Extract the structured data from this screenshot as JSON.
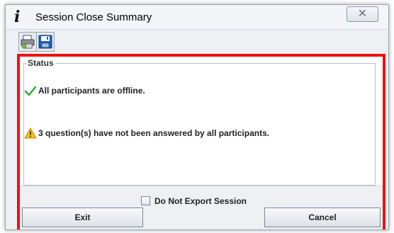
{
  "window": {
    "title": "Session Close Summary",
    "title_icon": "info-icon",
    "close_glyph": "✕"
  },
  "toolbar": {
    "buttons": [
      {
        "name": "print",
        "icon": "printer-icon"
      },
      {
        "name": "save",
        "icon": "floppy-disk-icon"
      }
    ]
  },
  "status": {
    "legend": "Status",
    "items": [
      {
        "icon": "check-icon",
        "text": "All participants are offline."
      },
      {
        "icon": "warning-icon",
        "text": "3 question(s) have not been answered by all participants."
      }
    ]
  },
  "options": {
    "do_not_export_label": "Do Not Export Session",
    "do_not_export_checked": false
  },
  "buttons": {
    "exit": "Exit",
    "cancel": "Cancel"
  },
  "colors": {
    "highlight_frame": "#ee1111",
    "check": "#2eaa2e",
    "warning": "#f4c20d"
  }
}
